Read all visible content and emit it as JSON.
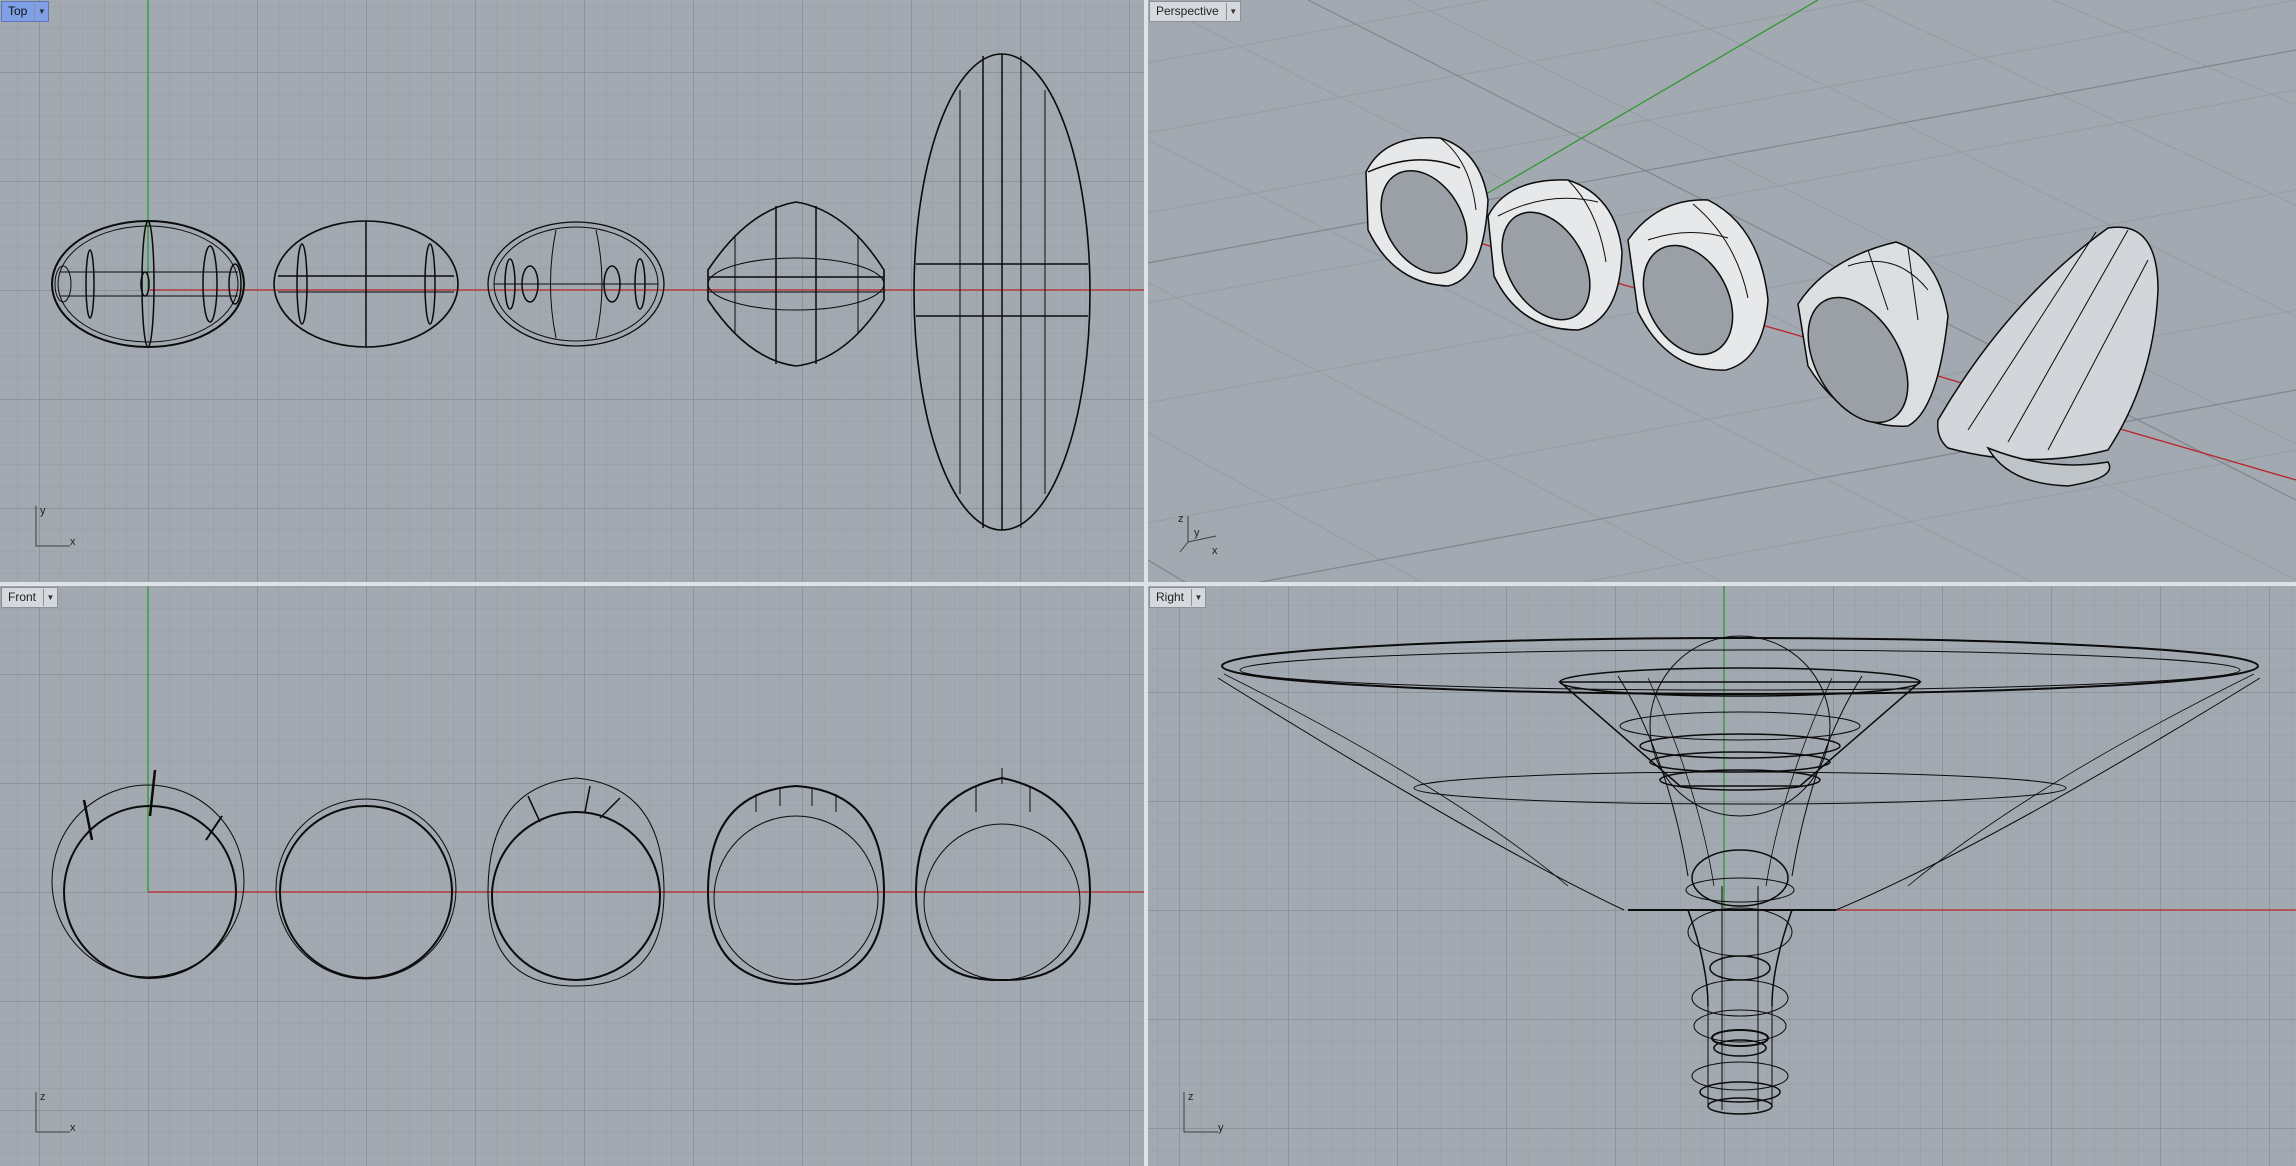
{
  "viewports": {
    "top": {
      "label": "Top",
      "active": true,
      "axis_a": "y",
      "axis_b": "x"
    },
    "perspective": {
      "label": "Perspective",
      "active": false,
      "axis_a": "z",
      "axis_b": "y",
      "axis_c": "x"
    },
    "front": {
      "label": "Front",
      "active": false,
      "axis_a": "z",
      "axis_b": "x"
    },
    "right": {
      "label": "Right",
      "active": false,
      "axis_a": "z",
      "axis_b": "y"
    }
  },
  "icons": {
    "viewport_menu": "chevron-down-icon",
    "axis_gizmo": "axis-gizmo-icon"
  },
  "colors": {
    "viewport_bg": "#a2a9b0",
    "grid_minor": "#949ba3",
    "grid_major": "#7f868e",
    "x_axis": "#b8262b",
    "y_axis": "#2f9a2f",
    "curves": "#0b0b0b",
    "active_tab": "#7f9fe6"
  }
}
